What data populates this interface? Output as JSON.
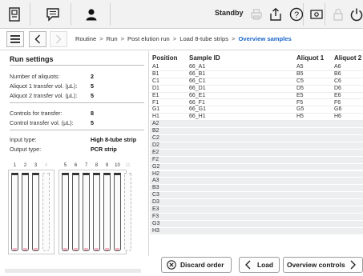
{
  "toolbar": {
    "status": "Standby",
    "icons": [
      "tray-icon",
      "message-icon",
      "user-icon",
      "printer-icon",
      "upload-icon",
      "help-icon",
      "screen-icon",
      "lock-icon",
      "power-icon"
    ]
  },
  "nav": {
    "breadcrumb": [
      "Routine",
      "Run",
      "Post elution run",
      "Load 8-tube strips",
      "Overview samples"
    ]
  },
  "run_settings": {
    "title": "Run settings",
    "number_of_aliquots_label": "Number of aliquots:",
    "number_of_aliquots": "2",
    "aliquot1_label": "Aliquot 1 transfer vol. (µL):",
    "aliquot1": "5",
    "aliquot2_label": "Aliquot 2 transfer vol. (µL):",
    "aliquot2": "5",
    "controls_label": "Controls for transfer:",
    "controls": "8",
    "control_vol_label": "Control transfer vol. (µL):",
    "control_vol": "5",
    "input_type_label": "Input type:",
    "input_type": "High 8-tube strip",
    "output_type_label": "Output type:",
    "output_type": "PCR strip"
  },
  "strips": {
    "numbers": [
      "1",
      "2",
      "3",
      "4",
      "5",
      "6",
      "7",
      "8",
      "9",
      "10",
      "11"
    ],
    "state": [
      "used",
      "used",
      "used",
      "empty",
      "used",
      "used",
      "used",
      "used",
      "used",
      "used",
      "empty"
    ]
  },
  "table": {
    "headers": [
      "Position",
      "Sample ID",
      "Aliquot 1",
      "Aliquot 2"
    ],
    "rows": [
      [
        "A1",
        "66_A1",
        "A5",
        "A6"
      ],
      [
        "B1",
        "66_B1",
        "B5",
        "B6"
      ],
      [
        "C1",
        "66_C1",
        "C5",
        "C6"
      ],
      [
        "D1",
        "66_D1",
        "D5",
        "D6"
      ],
      [
        "E1",
        "66_E1",
        "E5",
        "E6"
      ],
      [
        "F1",
        "66_F1",
        "F5",
        "F6"
      ],
      [
        "G1",
        "66_G1",
        "G5",
        "G6"
      ],
      [
        "H1",
        "66_H1",
        "H5",
        "H6"
      ],
      [
        "A2",
        "",
        "",
        ""
      ],
      [
        "B2",
        "",
        "",
        ""
      ],
      [
        "C2",
        "",
        "",
        ""
      ],
      [
        "D2",
        "",
        "",
        ""
      ],
      [
        "E2",
        "",
        "",
        ""
      ],
      [
        "F2",
        "",
        "",
        ""
      ],
      [
        "G2",
        "",
        "",
        ""
      ],
      [
        "H2",
        "",
        "",
        ""
      ],
      [
        "A3",
        "",
        "",
        ""
      ],
      [
        "B3",
        "",
        "",
        ""
      ],
      [
        "C3",
        "",
        "",
        ""
      ],
      [
        "D3",
        "",
        "",
        ""
      ],
      [
        "E3",
        "",
        "",
        ""
      ],
      [
        "F3",
        "",
        "",
        ""
      ],
      [
        "G3",
        "",
        "",
        ""
      ],
      [
        "H3",
        "",
        "",
        ""
      ]
    ]
  },
  "footer": {
    "discard_label": "Discard order",
    "load_label": "Load",
    "overview_controls_label": "Overview controls"
  }
}
